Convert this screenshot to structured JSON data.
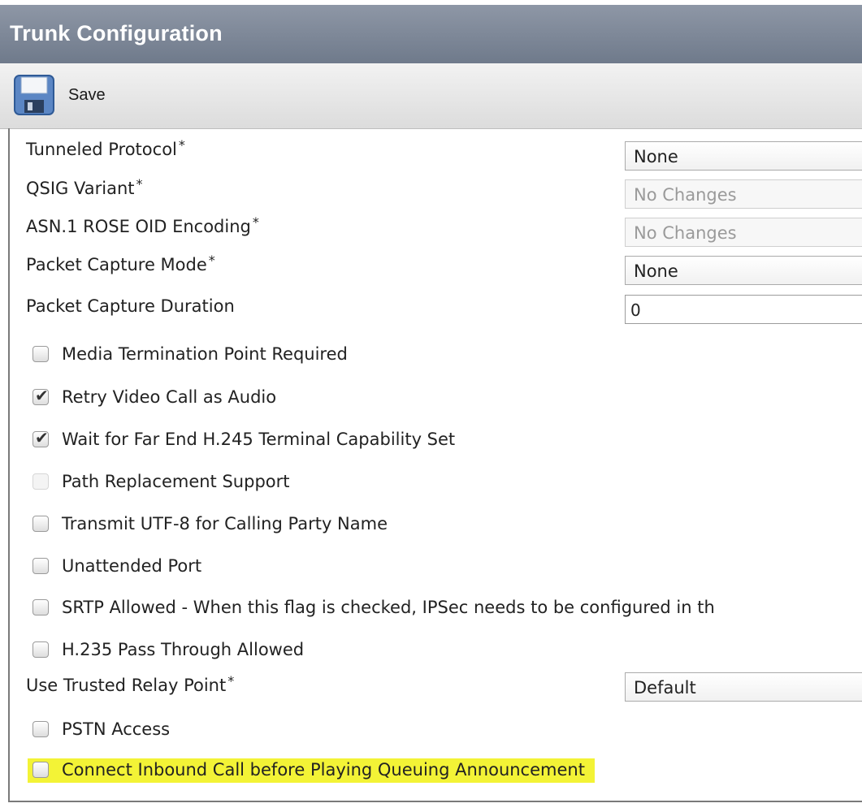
{
  "window": {
    "title": "Trunk Configuration"
  },
  "toolbar": {
    "save_label": "Save"
  },
  "fields": [
    {
      "label": "Tunneled Protocol",
      "required": "*",
      "value": "None",
      "kind": "select",
      "disabled": false
    },
    {
      "label": "QSIG Variant",
      "required": "*",
      "value": "No Changes",
      "kind": "select",
      "disabled": true
    },
    {
      "label": "ASN.1 ROSE OID Encoding",
      "required": "*",
      "value": "No Changes",
      "kind": "select",
      "disabled": true
    },
    {
      "label": "Packet Capture Mode",
      "required": "*",
      "value": "None",
      "kind": "select",
      "disabled": false
    },
    {
      "label": "Packet Capture Duration",
      "required": "",
      "value": "0",
      "kind": "text",
      "disabled": false
    }
  ],
  "checkboxes": [
    {
      "label": "Media Termination Point Required",
      "checked": false,
      "disabled": false
    },
    {
      "label": "Retry Video Call as Audio",
      "checked": true,
      "disabled": false
    },
    {
      "label": "Wait for Far End H.245 Terminal Capability Set",
      "checked": true,
      "disabled": false
    },
    {
      "label": "Path Replacement Support",
      "checked": false,
      "disabled": true
    },
    {
      "label": "Transmit UTF-8 for Calling Party Name",
      "checked": false,
      "disabled": false
    },
    {
      "label": "Unattended Port",
      "checked": false,
      "disabled": false
    },
    {
      "label": "SRTP Allowed - When this flag is checked, IPSec needs to be configured in th",
      "checked": false,
      "disabled": false
    },
    {
      "label": "H.235 Pass Through Allowed",
      "checked": false,
      "disabled": false
    }
  ],
  "trusted_relay": {
    "label": "Use Trusted Relay Point",
    "required": "*",
    "value": "Default"
  },
  "pstn": {
    "label": "PSTN Access",
    "checked": false
  },
  "connect_inbound": {
    "label": "Connect Inbound Call before Playing Queuing Announcement",
    "checked": false,
    "highlight_color": "#f3f336"
  },
  "colors": {
    "title_bar": "#6f7a8b",
    "highlight": "#f3f336"
  }
}
